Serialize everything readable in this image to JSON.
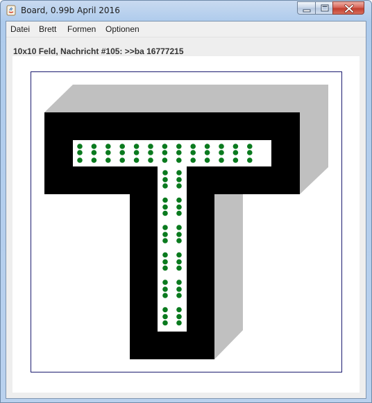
{
  "window": {
    "title": "Board, 0.99b April 2016",
    "app_icon": "java-icon",
    "controls": [
      "minimize-icon",
      "maximize-icon",
      "close-icon"
    ]
  },
  "menu": {
    "items": [
      {
        "label": "Datei"
      },
      {
        "label": "Brett"
      },
      {
        "label": "Formen"
      },
      {
        "label": "Optionen"
      }
    ]
  },
  "status": {
    "message": "10x10 Feld, Nachricht #105: >>ba 16777215"
  },
  "board": {
    "shape": "T",
    "colors": {
      "shape": "#000000",
      "shadow": "#c0c0c0",
      "channel": "#ffffff",
      "dots": "#0a7a1e",
      "frame": "#1a1a6e"
    },
    "horizontal_bar_dot_pairs": 13,
    "vertical_stem_dot_groups": 6
  }
}
